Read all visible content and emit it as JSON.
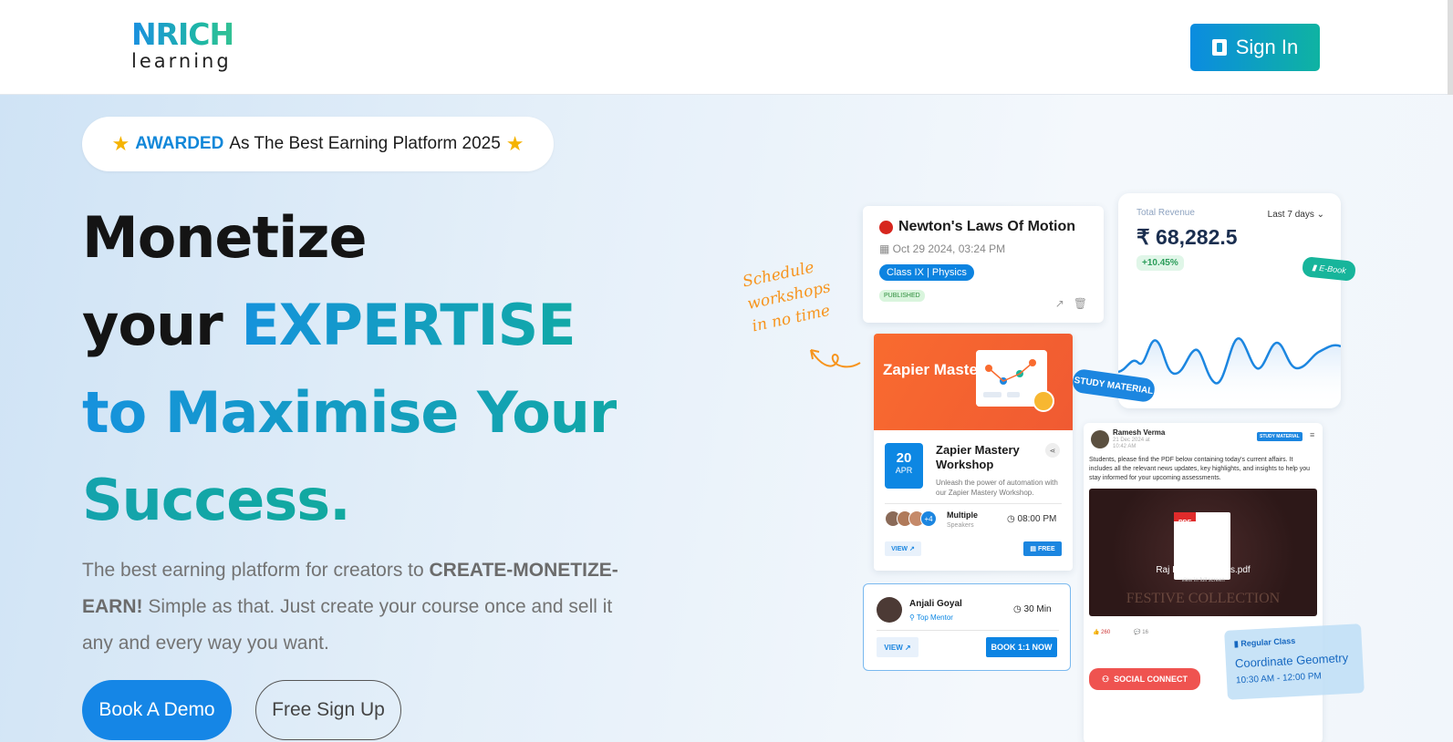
{
  "header": {
    "logo_top": "NRICH",
    "logo_bottom": "learning",
    "signin_label": "Sign In"
  },
  "award": {
    "highlight": "AWARDED",
    "text": "As The Best Earning Platform 2025"
  },
  "hero": {
    "line1": "Monetize",
    "line2_plain": "your ",
    "line2_grad": "EXPERTISE",
    "line3": "to Maximise Your",
    "line4": "Success.",
    "desc_plain1": "The best earning platform for creators to ",
    "desc_bold": "CREATE-MONETIZE-EARN!",
    "desc_plain2": " Simple as that. Just create your course once and sell it any and every way you want.",
    "book_demo": "Book A Demo",
    "free_signup": "Free Sign Up"
  },
  "newton": {
    "title": "Newton's Laws Of Motion",
    "date": "Oct 29 2024, 03:24 PM",
    "tag": "Class IX | Physics",
    "status": "PUBLISHED"
  },
  "revenue": {
    "label": "Total Revenue",
    "period": "Last 7 days",
    "amount": "₹ 68,282.5",
    "change": "+10.45%"
  },
  "ebook": {
    "label": "E-Book"
  },
  "study_tag": {
    "label": "STUDY MATERIAL"
  },
  "schedule_note": {
    "line1": "Schedule",
    "line2": "workshops",
    "line3": "in no time"
  },
  "zapier": {
    "banner_title": "Zapier Mastery",
    "day": "20",
    "month": "APR",
    "title": "Zapier Mastery Workshop",
    "subtitle": "Unleash the power of automation with our Zapier Mastery Workshop.",
    "more": "+4",
    "speakers_label": "Multiple",
    "speakers_sub": "Speakers",
    "time": "08:00 PM",
    "view": "VIEW",
    "free": "FREE"
  },
  "post": {
    "author": "Ramesh Verma",
    "date": "21 Dec 2024 at 10:42 AM",
    "tag": "STUDY MATERIAL",
    "text": "Students, please find the PDF below containing today's current affairs. It includes all the relevant news updates, key highlights, and insights to help you stay informed for your upcoming assessments.",
    "pdf_label": "PDF",
    "file_name": "Raj IAS Daily News.pdf",
    "view_full": "view in full screen",
    "bg_text": "FESTIVE COLLECTION",
    "likes": "260",
    "comments": "16"
  },
  "social": {
    "label": "SOCIAL CONNECT"
  },
  "geometry": {
    "badge": "Regular Class",
    "title": "Coordinate Geometry",
    "time": "10:30 AM - 12:00 PM"
  },
  "mentor": {
    "name": "Anjali Goyal",
    "role": "Top Mentor",
    "duration": "30 Min",
    "view": "VIEW",
    "book": "BOOK 1:1 NOW"
  },
  "colors": {
    "accent": "#1586e6",
    "teal": "#12a9a6",
    "social": "#ef5350",
    "orange": "#f7941d"
  }
}
